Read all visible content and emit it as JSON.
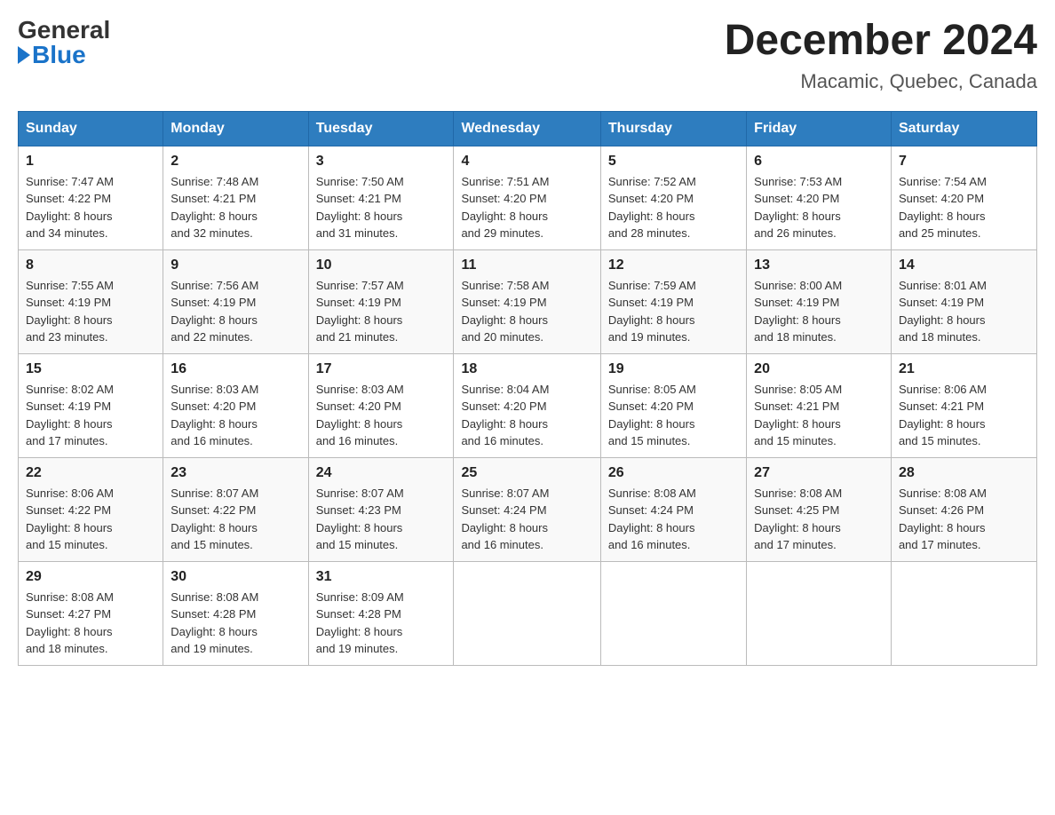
{
  "header": {
    "logo_general": "General",
    "logo_blue": "Blue",
    "title": "December 2024",
    "subtitle": "Macamic, Quebec, Canada"
  },
  "days_of_week": [
    "Sunday",
    "Monday",
    "Tuesday",
    "Wednesday",
    "Thursday",
    "Friday",
    "Saturday"
  ],
  "weeks": [
    [
      {
        "day": "1",
        "sunrise": "7:47 AM",
        "sunset": "4:22 PM",
        "daylight": "8 hours and 34 minutes."
      },
      {
        "day": "2",
        "sunrise": "7:48 AM",
        "sunset": "4:21 PM",
        "daylight": "8 hours and 32 minutes."
      },
      {
        "day": "3",
        "sunrise": "7:50 AM",
        "sunset": "4:21 PM",
        "daylight": "8 hours and 31 minutes."
      },
      {
        "day": "4",
        "sunrise": "7:51 AM",
        "sunset": "4:20 PM",
        "daylight": "8 hours and 29 minutes."
      },
      {
        "day": "5",
        "sunrise": "7:52 AM",
        "sunset": "4:20 PM",
        "daylight": "8 hours and 28 minutes."
      },
      {
        "day": "6",
        "sunrise": "7:53 AM",
        "sunset": "4:20 PM",
        "daylight": "8 hours and 26 minutes."
      },
      {
        "day": "7",
        "sunrise": "7:54 AM",
        "sunset": "4:20 PM",
        "daylight": "8 hours and 25 minutes."
      }
    ],
    [
      {
        "day": "8",
        "sunrise": "7:55 AM",
        "sunset": "4:19 PM",
        "daylight": "8 hours and 23 minutes."
      },
      {
        "day": "9",
        "sunrise": "7:56 AM",
        "sunset": "4:19 PM",
        "daylight": "8 hours and 22 minutes."
      },
      {
        "day": "10",
        "sunrise": "7:57 AM",
        "sunset": "4:19 PM",
        "daylight": "8 hours and 21 minutes."
      },
      {
        "day": "11",
        "sunrise": "7:58 AM",
        "sunset": "4:19 PM",
        "daylight": "8 hours and 20 minutes."
      },
      {
        "day": "12",
        "sunrise": "7:59 AM",
        "sunset": "4:19 PM",
        "daylight": "8 hours and 19 minutes."
      },
      {
        "day": "13",
        "sunrise": "8:00 AM",
        "sunset": "4:19 PM",
        "daylight": "8 hours and 18 minutes."
      },
      {
        "day": "14",
        "sunrise": "8:01 AM",
        "sunset": "4:19 PM",
        "daylight": "8 hours and 18 minutes."
      }
    ],
    [
      {
        "day": "15",
        "sunrise": "8:02 AM",
        "sunset": "4:19 PM",
        "daylight": "8 hours and 17 minutes."
      },
      {
        "day": "16",
        "sunrise": "8:03 AM",
        "sunset": "4:20 PM",
        "daylight": "8 hours and 16 minutes."
      },
      {
        "day": "17",
        "sunrise": "8:03 AM",
        "sunset": "4:20 PM",
        "daylight": "8 hours and 16 minutes."
      },
      {
        "day": "18",
        "sunrise": "8:04 AM",
        "sunset": "4:20 PM",
        "daylight": "8 hours and 16 minutes."
      },
      {
        "day": "19",
        "sunrise": "8:05 AM",
        "sunset": "4:20 PM",
        "daylight": "8 hours and 15 minutes."
      },
      {
        "day": "20",
        "sunrise": "8:05 AM",
        "sunset": "4:21 PM",
        "daylight": "8 hours and 15 minutes."
      },
      {
        "day": "21",
        "sunrise": "8:06 AM",
        "sunset": "4:21 PM",
        "daylight": "8 hours and 15 minutes."
      }
    ],
    [
      {
        "day": "22",
        "sunrise": "8:06 AM",
        "sunset": "4:22 PM",
        "daylight": "8 hours and 15 minutes."
      },
      {
        "day": "23",
        "sunrise": "8:07 AM",
        "sunset": "4:22 PM",
        "daylight": "8 hours and 15 minutes."
      },
      {
        "day": "24",
        "sunrise": "8:07 AM",
        "sunset": "4:23 PM",
        "daylight": "8 hours and 15 minutes."
      },
      {
        "day": "25",
        "sunrise": "8:07 AM",
        "sunset": "4:24 PM",
        "daylight": "8 hours and 16 minutes."
      },
      {
        "day": "26",
        "sunrise": "8:08 AM",
        "sunset": "4:24 PM",
        "daylight": "8 hours and 16 minutes."
      },
      {
        "day": "27",
        "sunrise": "8:08 AM",
        "sunset": "4:25 PM",
        "daylight": "8 hours and 17 minutes."
      },
      {
        "day": "28",
        "sunrise": "8:08 AM",
        "sunset": "4:26 PM",
        "daylight": "8 hours and 17 minutes."
      }
    ],
    [
      {
        "day": "29",
        "sunrise": "8:08 AM",
        "sunset": "4:27 PM",
        "daylight": "8 hours and 18 minutes."
      },
      {
        "day": "30",
        "sunrise": "8:08 AM",
        "sunset": "4:28 PM",
        "daylight": "8 hours and 19 minutes."
      },
      {
        "day": "31",
        "sunrise": "8:09 AM",
        "sunset": "4:28 PM",
        "daylight": "8 hours and 19 minutes."
      },
      null,
      null,
      null,
      null
    ]
  ],
  "labels": {
    "sunrise": "Sunrise:",
    "sunset": "Sunset:",
    "daylight": "Daylight:"
  }
}
